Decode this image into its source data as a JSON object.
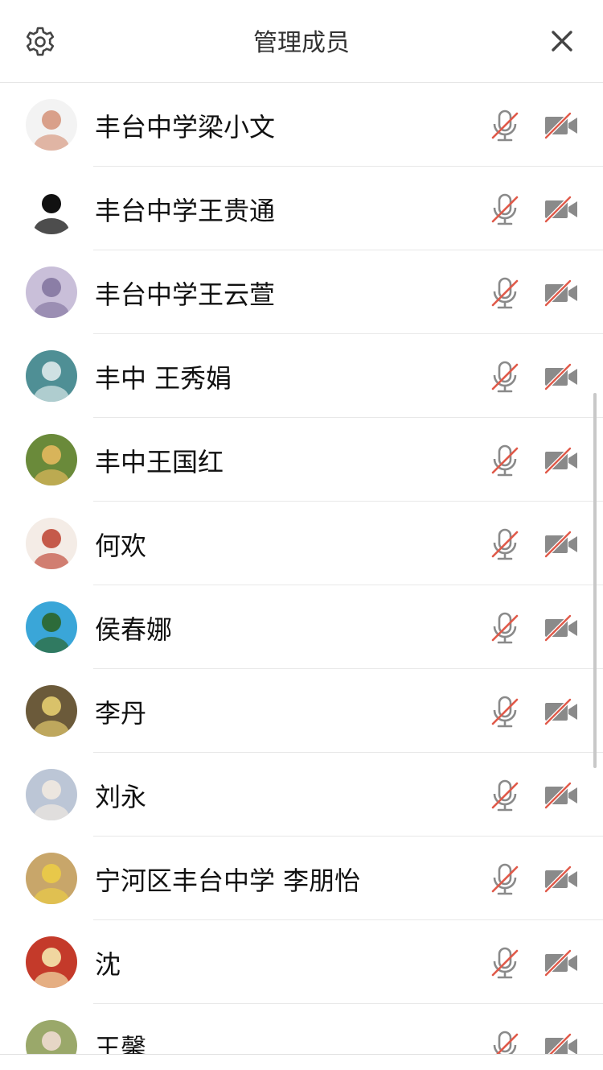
{
  "header": {
    "title": "管理成员"
  },
  "members": [
    {
      "name": "丰台中学梁小文",
      "avatar_bg": "#f3f3f3",
      "avatar_fg": "#d9a08a",
      "mic_muted": true,
      "cam_off": true
    },
    {
      "name": "丰台中学王贵通",
      "avatar_bg": "#ffffff",
      "avatar_fg": "#111111",
      "mic_muted": true,
      "cam_off": true
    },
    {
      "name": "丰台中学王云萱",
      "avatar_bg": "#c9bfd9",
      "avatar_fg": "#8b7ea6",
      "mic_muted": true,
      "cam_off": true
    },
    {
      "name": "丰中 王秀娟",
      "avatar_bg": "#4f8f95",
      "avatar_fg": "#cfe1e3",
      "mic_muted": true,
      "cam_off": true
    },
    {
      "name": "丰中王国红",
      "avatar_bg": "#6a8a3a",
      "avatar_fg": "#d8b45a",
      "mic_muted": true,
      "cam_off": true
    },
    {
      "name": "何欢",
      "avatar_bg": "#f4ece6",
      "avatar_fg": "#c55a4a",
      "mic_muted": true,
      "cam_off": true
    },
    {
      "name": "侯春娜",
      "avatar_bg": "#3aa6d8",
      "avatar_fg": "#2d6b3a",
      "mic_muted": true,
      "cam_off": true
    },
    {
      "name": "李丹",
      "avatar_bg": "#6b5a3a",
      "avatar_fg": "#d9c26a",
      "mic_muted": true,
      "cam_off": true
    },
    {
      "name": "刘永",
      "avatar_bg": "#bcc6d6",
      "avatar_fg": "#ece6df",
      "mic_muted": true,
      "cam_off": true
    },
    {
      "name": "宁河区丰台中学 李朋怡",
      "avatar_bg": "#c8a66a",
      "avatar_fg": "#e8c84a",
      "mic_muted": true,
      "cam_off": true
    },
    {
      "name": "沈",
      "avatar_bg": "#c43a2a",
      "avatar_fg": "#f0d6a0",
      "mic_muted": true,
      "cam_off": true
    },
    {
      "name": "王馨",
      "avatar_bg": "#9aa86a",
      "avatar_fg": "#e6d6c6",
      "mic_muted": true,
      "cam_off": true
    }
  ],
  "colors": {
    "slash": "#e05a4a",
    "icon": "#8a8a8a"
  }
}
